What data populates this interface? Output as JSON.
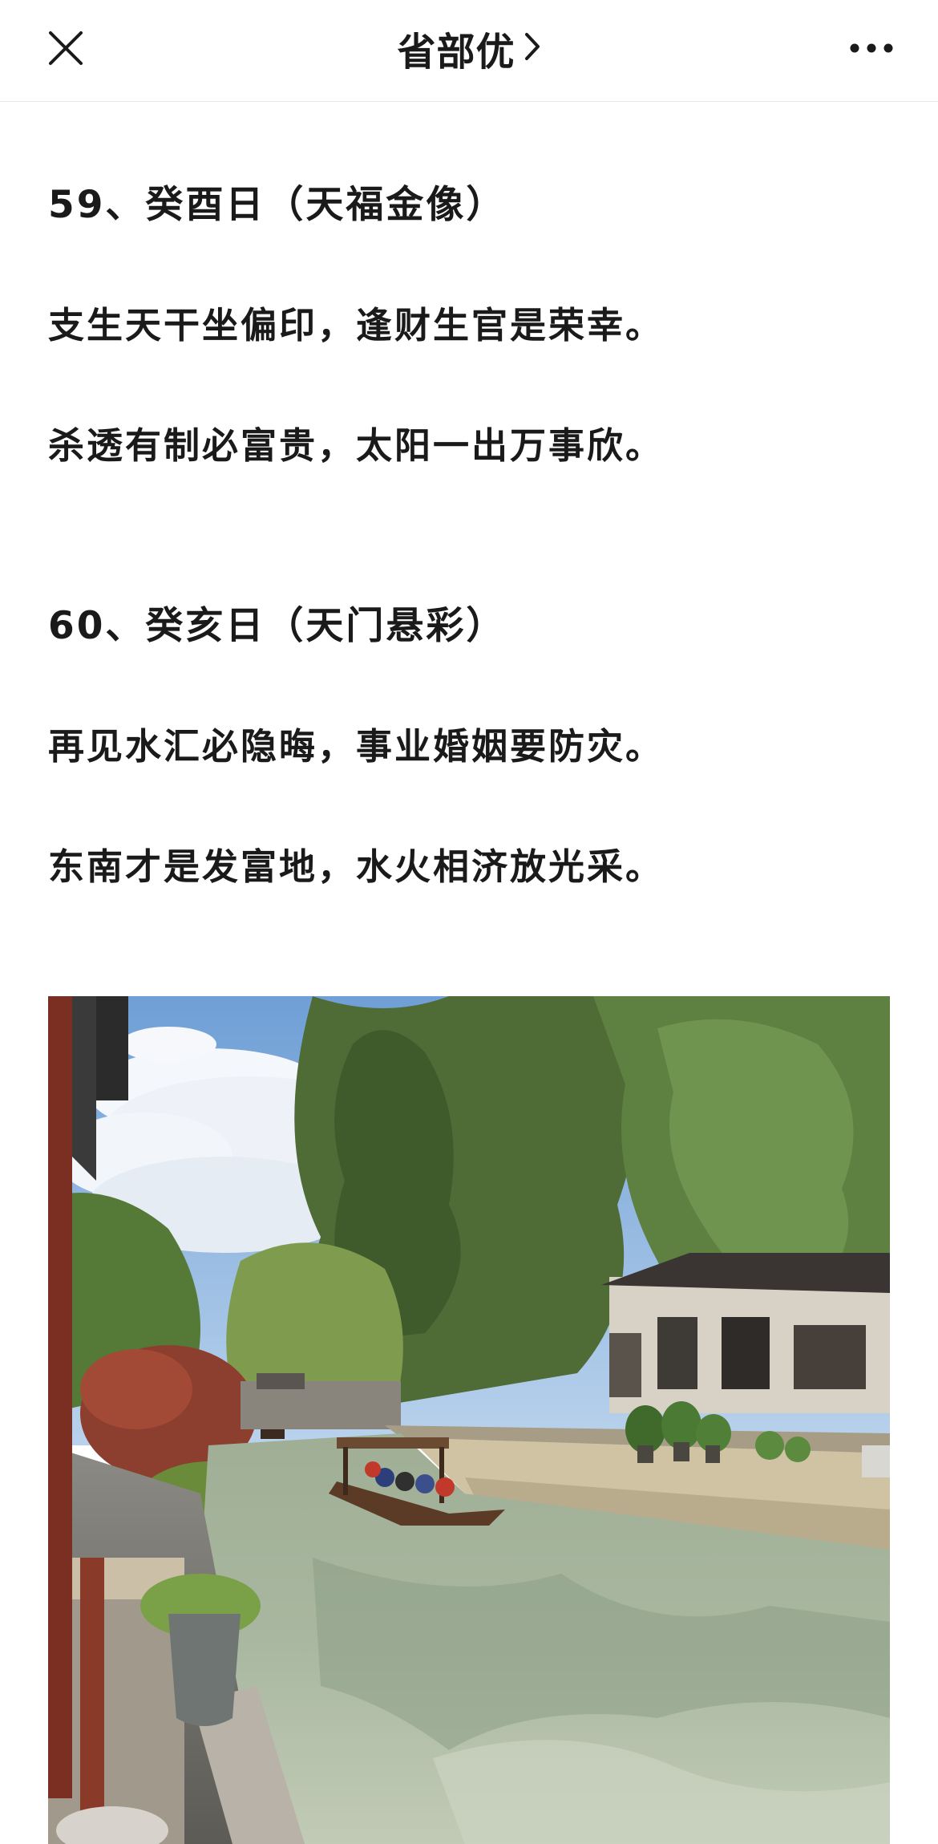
{
  "navbar": {
    "close_icon": "close-icon",
    "title": "省部优",
    "title_chevron_icon": "chevron-right-icon",
    "more_icon": "more-dots-icon"
  },
  "article": {
    "paragraphs": [
      "59、癸酉日（天福金像）",
      "支生天干坐偏印，逢财生官是荣幸。",
      "杀透有制必富贵，太阳一出万事欣。",
      "60、癸亥日（天门悬彩）",
      "再见水汇必隐晦，事业婚姻要防灾。",
      "东南才是发富地，水火相济放光采。"
    ]
  },
  "image": {
    "subject": "canal-town-photo"
  },
  "colors": {
    "text": "#1a1a1a",
    "background": "#ffffff",
    "divider": "#e6e6e6"
  }
}
